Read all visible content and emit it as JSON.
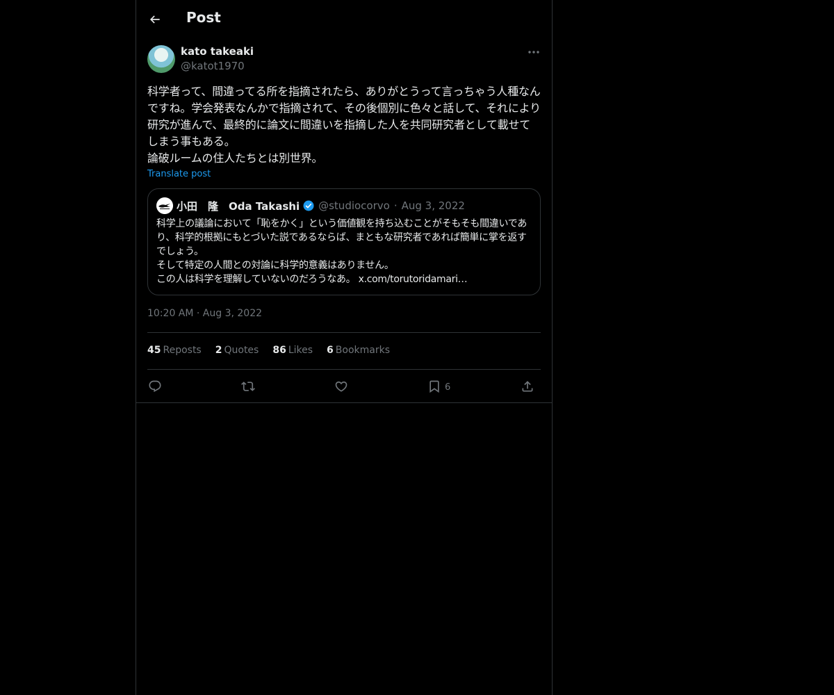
{
  "header": {
    "title": "Post"
  },
  "post": {
    "author_name": "kato takeaki",
    "author_handle": "@katot1970",
    "text": "科学者って、間違ってる所を指摘されたら、ありがとうって言っちゃう人種なんですね。学会発表なんかで指摘されて、その後個別に色々と話して、それにより研究が進んで、最終的に論文に間違いを指摘した人を共同研究者として載せてしまう事もある。\n論破ルームの住人たちとは別世界。",
    "translate_label": "Translate post",
    "timestamp": "10:20 AM · Aug 3, 2022"
  },
  "quote": {
    "author_name": "小田　隆　Oda Takashi",
    "author_handle": "@studiocorvo",
    "separator": "·",
    "date": "Aug 3, 2022",
    "text": "科学上の議論において「恥をかく」という価値観を持ち込むことがそもそも間違いであり、科学的根拠にもとづいた説であるならば、まともな研究者であれば簡単に掌を返すでしょう。\nそして特定の人間との対論に科学的意義はありません。\nこの人は科学を理解していないのだろうなあ。 x.com/torutoridamari…"
  },
  "stats": [
    {
      "num": "45",
      "label": "Reposts"
    },
    {
      "num": "2",
      "label": "Quotes"
    },
    {
      "num": "86",
      "label": "Likes"
    },
    {
      "num": "6",
      "label": "Bookmarks"
    }
  ],
  "actions": {
    "bookmark_count": "6"
  },
  "colors": {
    "background": "#000000",
    "text": "#e7e9ea",
    "muted": "#71767b",
    "accent": "#1d9bf0",
    "border": "#2f3336"
  }
}
